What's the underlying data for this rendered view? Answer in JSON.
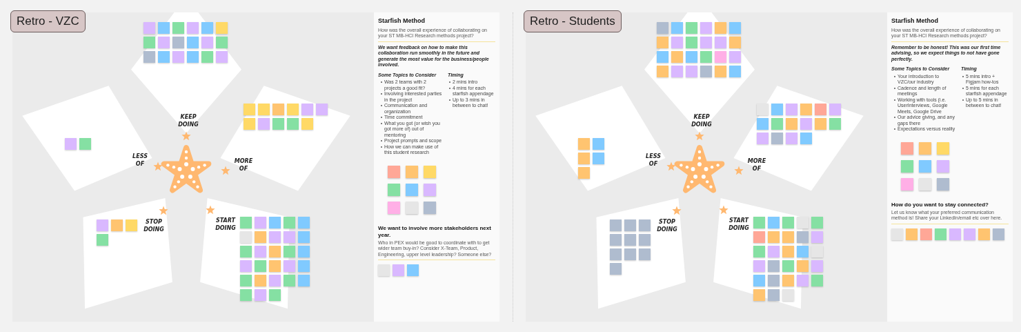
{
  "boards": [
    {
      "title": "Retro - VZC",
      "sections": [
        {
          "label": "KEEP DOING",
          "stickies": [
            {
              "color": "#d9b8ff"
            },
            {
              "color": "#80caff"
            },
            {
              "color": "#85e0a3"
            },
            {
              "color": "#d9b8ff"
            },
            {
              "color": "#80caff"
            },
            {
              "color": "#ffd966"
            },
            {
              "color": "#85e0a3"
            },
            {
              "color": "#d9b8ff"
            },
            {
              "color": "#afbccf"
            },
            {
              "color": "#80caff"
            },
            {
              "color": "#d9b8ff"
            },
            {
              "color": "#85e0a3"
            },
            {
              "color": "#afbccf"
            },
            {
              "color": "#80caff"
            },
            {
              "color": "#d9b8ff"
            },
            {
              "color": "#80caff"
            },
            {
              "color": "#85e0a3"
            },
            {
              "color": "#d9b8ff"
            }
          ]
        },
        {
          "label": "LESS OF",
          "stickies": [
            {
              "color": "#d9b8ff"
            },
            {
              "color": "#85e0a3"
            }
          ]
        },
        {
          "label": "MORE OF",
          "stickies": [
            {
              "color": "#ffd966"
            },
            {
              "color": "#ffd966"
            },
            {
              "color": "#ffc470"
            },
            {
              "color": "#ffd966"
            },
            {
              "color": "#d9b8ff"
            },
            {
              "color": "#d9b8ff"
            },
            {
              "color": "#ffd966"
            },
            {
              "color": "#d9b8ff"
            },
            {
              "color": "#85e0a3"
            },
            {
              "color": "#85e0a3"
            },
            {
              "color": "#ffd966"
            }
          ]
        },
        {
          "label": "STOP DOING",
          "stickies": [
            {
              "color": "#d9b8ff"
            },
            {
              "color": "#ffc470"
            },
            {
              "color": "#ffd966"
            },
            {
              "color": "#85e0a3"
            }
          ]
        },
        {
          "label": "START DOING",
          "stickies": [
            {
              "color": "#85e0a3"
            },
            {
              "color": "#d9b8ff"
            },
            {
              "color": "#80caff"
            },
            {
              "color": "#85e0a3"
            },
            {
              "color": "#80caff"
            },
            {
              "color": "#e6e6e6"
            },
            {
              "color": "#ffc470"
            },
            {
              "color": "#d9b8ff"
            },
            {
              "color": "#d9b8ff"
            },
            {
              "color": "#80caff"
            },
            {
              "color": "#85e0a3"
            },
            {
              "color": "#d9b8ff"
            },
            {
              "color": "#ffc470"
            },
            {
              "color": "#85e0a3"
            },
            {
              "color": "#80caff"
            },
            {
              "color": "#d9b8ff"
            },
            {
              "color": "#85e0a3"
            },
            {
              "color": "#ffc470"
            },
            {
              "color": "#d9b8ff"
            },
            {
              "color": "#80caff"
            },
            {
              "color": "#85e0a3"
            },
            {
              "color": "#ffc470"
            },
            {
              "color": "#d9b8ff"
            },
            {
              "color": "#85e0a3"
            },
            {
              "color": "#80caff"
            },
            {
              "color": "#85e0a3"
            },
            {
              "color": "#d9b8ff"
            },
            {
              "color": "#85e0a3"
            }
          ]
        }
      ],
      "sidebar": {
        "heading": "Starfish Method",
        "question": "How was the overall experience of collaborating on your ST MB-HCI Research methods project?",
        "note": "We want feedback on how to make this collaboration run smoothly in the future and generate the most value for the business/people involved.",
        "topics": {
          "title": "Some Topics to Consider",
          "items": [
            "Was 2 teams with 2 projects a good fit?",
            "Involving interested parties in the project",
            "Communication and organization",
            "Time commitment",
            "What you got (or wish you got more of) out of mentoring",
            "Project prompts and scope",
            "How we can make use of this student research"
          ]
        },
        "timing": {
          "title": "Timing",
          "items": [
            "2 mins intro",
            "4 mins for each starfish appendage",
            "Up to 3 mins in between to chat!"
          ]
        },
        "palette": [
          {
            "color": "#ffa797"
          },
          {
            "color": "#ffc470"
          },
          {
            "color": "#ffd966"
          },
          {
            "color": "#85e0a3"
          },
          {
            "color": "#80caff"
          },
          {
            "color": "#d9b8ff"
          },
          {
            "color": "#ffafe6"
          },
          {
            "color": "#e6e6e6"
          },
          {
            "color": "#afbccf"
          }
        ],
        "extra": {
          "heading": "We want to involve more stakeholders next year.",
          "text": "Who in PEX would be good to coordinate with to get wider team buy-in? Consider X-Team, Product, Engineering, upper level leadership? Someone else?",
          "stickies": [
            {
              "color": "#e6e6e6"
            },
            {
              "color": "#d9b8ff"
            },
            {
              "color": "#80caff"
            }
          ]
        }
      }
    },
    {
      "title": "Retro - Students",
      "sections": [
        {
          "label": "KEEP DOING",
          "stickies": [
            {
              "color": "#afbccf"
            },
            {
              "color": "#80caff"
            },
            {
              "color": "#85e0a3"
            },
            {
              "color": "#d9b8ff"
            },
            {
              "color": "#ffc470"
            },
            {
              "color": "#80caff"
            },
            {
              "color": "#ffc470"
            },
            {
              "color": "#d9b8ff"
            },
            {
              "color": "#85e0a3"
            },
            {
              "color": "#d9b8ff"
            },
            {
              "color": "#d9b8ff"
            },
            {
              "color": "#ffc470"
            },
            {
              "color": "#80caff"
            },
            {
              "color": "#ffc470"
            },
            {
              "color": "#80caff"
            },
            {
              "color": "#85e0a3"
            },
            {
              "color": "#ffafe6"
            },
            {
              "color": "#d9b8ff"
            },
            {
              "color": "#ffc470"
            },
            {
              "color": "#d9b8ff"
            },
            {
              "color": "#d9b8ff"
            },
            {
              "color": "#afbccf"
            },
            {
              "color": "#ffc470"
            },
            {
              "color": "#80caff"
            }
          ]
        },
        {
          "label": "LESS OF",
          "stickies": [
            {
              "color": "#ffc470"
            },
            {
              "color": "#80caff"
            },
            {
              "color": "#ffc470"
            },
            {
              "color": "#80caff"
            },
            {
              "color": "#ffc470"
            }
          ]
        },
        {
          "label": "MORE OF",
          "stickies": [
            {
              "color": "#e6e6e6"
            },
            {
              "color": "#80caff"
            },
            {
              "color": "#d9b8ff"
            },
            {
              "color": "#ffc470"
            },
            {
              "color": "#ffa797"
            },
            {
              "color": "#d9b8ff"
            },
            {
              "color": "#80caff"
            },
            {
              "color": "#85e0a3"
            },
            {
              "color": "#ffc470"
            },
            {
              "color": "#d9b8ff"
            },
            {
              "color": "#ffc470"
            },
            {
              "color": "#85e0a3"
            },
            {
              "color": "#d9b8ff"
            },
            {
              "color": "#afbccf"
            },
            {
              "color": "#d9b8ff"
            },
            {
              "color": "#80caff"
            }
          ]
        },
        {
          "label": "STOP DOING",
          "stickies": [
            {
              "color": "#afbccf"
            },
            {
              "color": "#afbccf"
            },
            {
              "color": "#afbccf"
            },
            {
              "color": "#afbccf"
            },
            {
              "color": "#afbccf"
            },
            {
              "color": "#afbccf"
            },
            {
              "color": "#afbccf"
            },
            {
              "color": "#afbccf"
            },
            {
              "color": "#afbccf"
            },
            {
              "color": "#afbccf"
            }
          ]
        },
        {
          "label": "START DOING",
          "stickies": [
            {
              "color": "#85e0a3"
            },
            {
              "color": "#80caff"
            },
            {
              "color": "#85e0a3"
            },
            {
              "color": "#e6e6e6"
            },
            {
              "color": "#85e0a3"
            },
            {
              "color": "#ffa797"
            },
            {
              "color": "#ffc470"
            },
            {
              "color": "#ffc470"
            },
            {
              "color": "#afbccf"
            },
            {
              "color": "#d9b8ff"
            },
            {
              "color": "#85e0a3"
            },
            {
              "color": "#d9b8ff"
            },
            {
              "color": "#ffc470"
            },
            {
              "color": "#80caff"
            },
            {
              "color": "#e6e6e6"
            },
            {
              "color": "#d9b8ff"
            },
            {
              "color": "#afbccf"
            },
            {
              "color": "#85e0a3"
            },
            {
              "color": "#ffc470"
            },
            {
              "color": "#d9b8ff"
            },
            {
              "color": "#80caff"
            },
            {
              "color": "#afbccf"
            },
            {
              "color": "#ffc470"
            },
            {
              "color": "#d9b8ff"
            },
            {
              "color": "#85e0a3"
            },
            {
              "color": "#ffc470"
            },
            {
              "color": "#afbccf"
            },
            {
              "color": "#e6e6e6"
            }
          ]
        }
      ],
      "sidebar": {
        "heading": "Starfish Method",
        "question": "How was the overall experience of collaborating on your ST MB-HCI Research methods project?",
        "note": "Remember to be honest! This was our first time advising, so we expect things to not have gone perfectly.",
        "topics": {
          "title": "Some Topics to Consider",
          "items": [
            "Your introduction to VZC/our industry",
            "Cadence and length of meetings",
            "Working with tools (i.e. UserInterviews, Google Meets, Google Drive",
            "Our advice giving, and any gaps there",
            "Expectations versus reality"
          ]
        },
        "timing": {
          "title": "Timing",
          "items": [
            "5 mins intro + Figjam how-tos",
            "5 mins for each starfish appendage",
            "Up to 5 mins in between to chat!"
          ]
        },
        "palette": [
          {
            "color": "#ffa797"
          },
          {
            "color": "#ffc470"
          },
          {
            "color": "#ffd966"
          },
          {
            "color": "#85e0a3"
          },
          {
            "color": "#80caff"
          },
          {
            "color": "#d9b8ff"
          },
          {
            "color": "#ffafe6"
          },
          {
            "color": "#e6e6e6"
          },
          {
            "color": "#afbccf"
          }
        ],
        "extra": {
          "heading": "How do you want to stay connected?",
          "text": "Let us know what your preferred communication method is! Share your LinkedIn/email etc over here.",
          "stickies": [
            {
              "color": "#e6e6e6"
            },
            {
              "color": "#ffc470"
            },
            {
              "color": "#ffa797"
            },
            {
              "color": "#85e0a3"
            },
            {
              "color": "#d9b8ff"
            },
            {
              "color": "#d9b8ff"
            },
            {
              "color": "#ffc470"
            },
            {
              "color": "#afbccf"
            }
          ]
        }
      }
    }
  ]
}
